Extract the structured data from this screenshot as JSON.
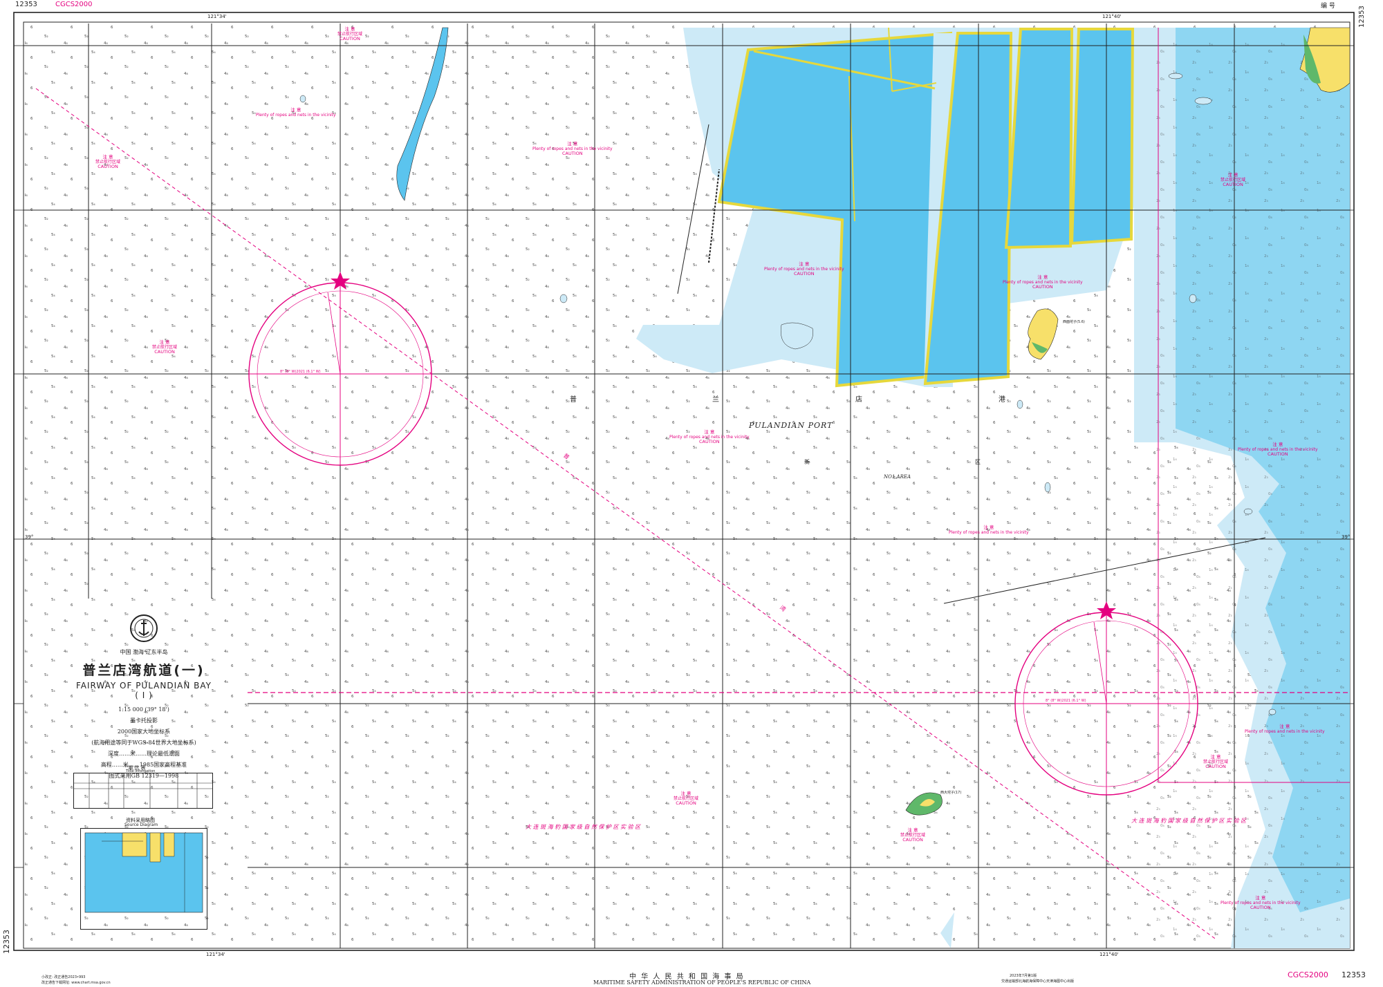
{
  "chart": {
    "number": "12353",
    "datum_top": "CGCS2000",
    "serial_label": "编 号",
    "title_region": "中国  渤海  辽东半岛",
    "title_cn": "普兰店湾航道(一)",
    "title_en": "FAIRWAY OF PULANDIAN BAY ( I )",
    "scale": "1:15 000 (39° 18')",
    "projection": "墨卡托投影",
    "datum_cn": "2000国家大地坐标系",
    "datum_note": "(航海用途等同于WGS-84世界大地坐标系)",
    "depth_note": "深度……米……理论最低潮面",
    "height_note": "高程……米……1985国家高程基准",
    "symbol_note": "图式采用GB 12319—1998",
    "tide_table_title": "潮  信  表",
    "tide_table_sub": "Tidal Information",
    "source_title": "资料采用略图",
    "source_sub": "Source Diagram",
    "publisher_cn": "中 华 人 民 共 和 国 海 事 局",
    "publisher_en": "MARITIME SAFETY ADMINISTRATION OF PEOPLE'S REPUBLIC OF CHINA",
    "edition": "2023年7月第1版",
    "left_note_1": "小改正: 改正通告2023•993",
    "left_note_2": "改正通告下载网址: www.chart.msa.gov.cn",
    "right_note": "交通运输部北海航海保障中心天津海图中心出版"
  },
  "labels": {
    "port_en": "PULANDIAN PORT",
    "port_cn": [
      "普",
      "兰",
      "店",
      "港"
    ],
    "area_en": "NO1 AREA",
    "area_cn": [
      "新",
      "区"
    ],
    "fairway_cn": [
      "普",
      "湾"
    ],
    "reserve_left": "大 连 斑 海 豹 国 家 级 自 然 保 护 区 实 验 区 ",
    "reserve_right": "大 连 斑 海 豹 国 家 级 自 然 保 护 区 实 验 区",
    "island_small": "西大坨子(17)",
    "island_east": "西面坨子(5.6)",
    "compass_left_var": "8° (8° W)2021  (6.1° W)",
    "compass_right_var": "8° (8° W)2021  (6.1° W)",
    "lon_left": "121°34'",
    "lon_right": "121°40'",
    "lat_mid": "39°"
  },
  "cautions": [
    {
      "cn": "注  意",
      "body": "禁止航行区域",
      "en": "CAUTION"
    },
    {
      "cn": "注  意",
      "body": "Plenty of ropes and nets in the vicinity",
      "en": "CAUTION"
    }
  ],
  "colors": {
    "deep_water": "#ffffff",
    "shallow_water": "#cdeaf7",
    "pond": "#5bc4ee",
    "pond_border": "#e6d83c",
    "land": "#f7e06a",
    "green": "#5fb86a",
    "magenta": "#e4007f"
  }
}
